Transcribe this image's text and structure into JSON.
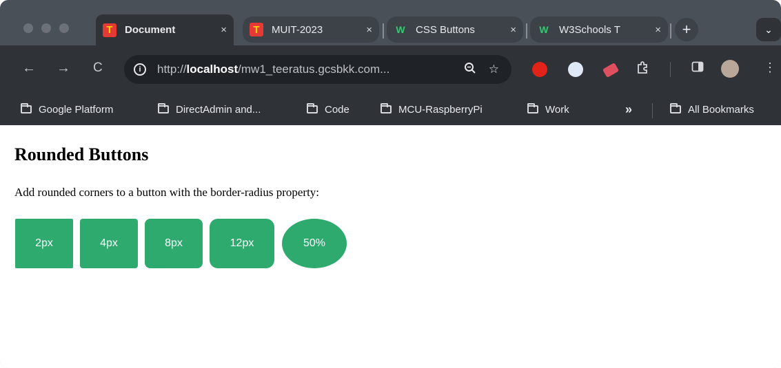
{
  "tabs": [
    {
      "title": "Document",
      "favicon": "T",
      "active": true
    },
    {
      "title": "MUIT-2023",
      "favicon": "T",
      "active": false
    },
    {
      "title": "CSS Buttons",
      "favicon": "W",
      "active": false
    },
    {
      "title": "W3Schools T",
      "favicon": "W",
      "active": false
    }
  ],
  "tab_close": "×",
  "new_tab": "+",
  "tab_menu": "⌄",
  "nav": {
    "back": "←",
    "forward": "→",
    "reload": "C"
  },
  "address": {
    "protocol": "http://",
    "host": "localhost",
    "path": "/mw1_teeratus.gcsbkk.com..."
  },
  "bookmarks": [
    "Google Platform",
    "DirectAdmin and...",
    "Code",
    "MCU-RaspberryPi",
    "Work"
  ],
  "bookmarks_more": "»",
  "all_bookmarks": "All Bookmarks",
  "page": {
    "heading": "Rounded Buttons",
    "description": "Add rounded corners to a button with the border-radius property:",
    "buttons": [
      "2px",
      "4px",
      "8px",
      "12px",
      "50%"
    ]
  },
  "colors": {
    "button_green": "#2eaa6e",
    "tab_strip": "#4a5058",
    "toolbar": "#2f3338"
  }
}
